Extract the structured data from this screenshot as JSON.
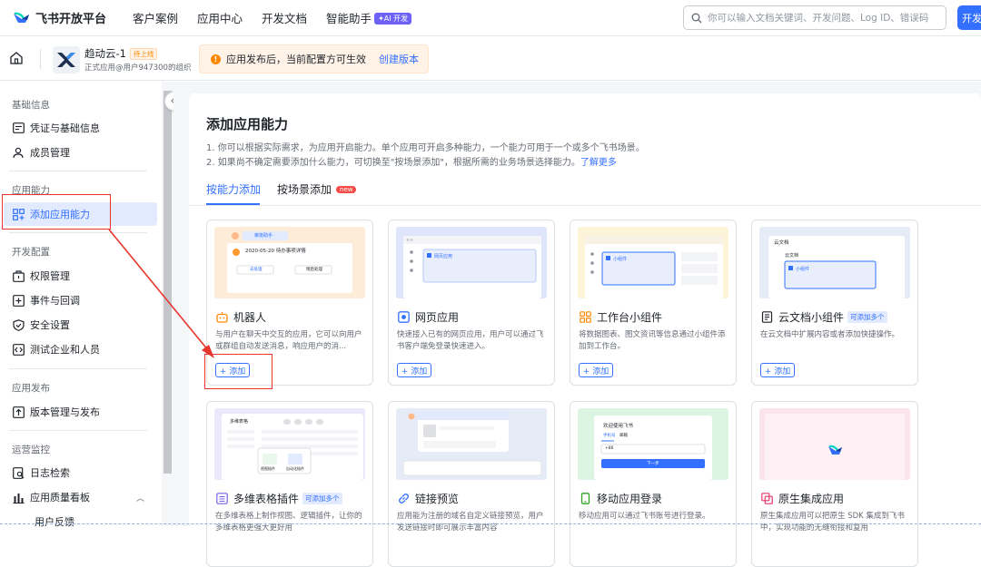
{
  "header": {
    "logo_text": "飞书开放平台",
    "nav": [
      "客户案例",
      "应用中心",
      "开发文档",
      "智能助手"
    ],
    "ai_badge": "✦AI 开发",
    "search_placeholder": "你可以输入文档关键词、开发问题、Log ID、错误码",
    "dev_button": "开发"
  },
  "app": {
    "name": "趋动云-1",
    "status": "待上线",
    "subtitle": "正式应用@用户947300的组织",
    "notice": "应用发布后，当前配置方可生效",
    "notice_link": "创建版本"
  },
  "sidebar": {
    "sections": [
      {
        "title": "基础信息",
        "items": [
          "凭证与基础信息",
          "成员管理"
        ]
      },
      {
        "title": "应用能力",
        "items": [
          "添加应用能力"
        ]
      },
      {
        "title": "开发配置",
        "items": [
          "权限管理",
          "事件与回调",
          "安全设置",
          "测试企业和人员"
        ]
      },
      {
        "title": "应用发布",
        "items": [
          "版本管理与发布"
        ]
      },
      {
        "title": "运营监控",
        "items": [
          "日志检索",
          "应用质量看板",
          "用户反馈"
        ]
      }
    ],
    "active": "添加应用能力"
  },
  "main": {
    "title": "添加应用能力",
    "desc1": "1. 你可以根据实际需求，为应用开启能力。单个应用可开启多种能力，一个能力可用于一个或多个飞书场景。",
    "desc2": "2. 如果尚不确定需要添加什么能力，可切换至\"按场景添加\"，根据所需的业务场景选择能力。",
    "learn_more": "了解更多",
    "tabs": [
      "按能力添加",
      "按场景添加"
    ],
    "new_badge": "new",
    "add_label": "+ 添加",
    "multi_badge": "可添加多个",
    "cards": [
      {
        "title": "机器人",
        "desc": "与用户在聊天中交互的应用，它可以向用户或群组自动发送消息，响应用户的消..."
      },
      {
        "title": "网页应用",
        "desc": "快速接入已有的网页应用，用户可以通过飞书客户端免登录快速进入。"
      },
      {
        "title": "工作台小组件",
        "desc": "将数据图表、图文资讯等信息通过小组件添加到工作台。"
      },
      {
        "title": "云文档小组件",
        "desc": "在云文档中扩展内容或者添加快捷操作。"
      },
      {
        "title": "多维表格插件",
        "desc": "在多维表格上制作视图、逻辑插件，让你的多维表格更强大更好用"
      },
      {
        "title": "链接预览",
        "desc": "应用能为注册的域名自定义链接预览，用户发送链接时即可展示丰富内容"
      },
      {
        "title": "移动应用登录",
        "desc": "移动应用可以通过飞书账号进行登录。"
      },
      {
        "title": "原生集成应用",
        "desc": "原生集成应用可以把原生 SDK 集成到飞书中，实现功能的无缝衔接和复用"
      }
    ],
    "thumb": {
      "robot_name": "审批助手",
      "robot_line": "2020-05-20 待办事项详情",
      "btn_left": "去处理",
      "btn_right": "稍后处理",
      "web_label": "网页应用",
      "widget_label": "小组件",
      "doc_header": "云文档",
      "doc_sub": "云文档",
      "doc_widget": "小组件",
      "table_header": "多维表格",
      "view_plugin": "视图插件",
      "auto_plugin": "自动化插件",
      "login_welcome": "欢迎使用飞书",
      "login_tab1": "手机号",
      "login_tab2": "邮箱",
      "login_code": "+86",
      "login_next": "下一步"
    }
  }
}
